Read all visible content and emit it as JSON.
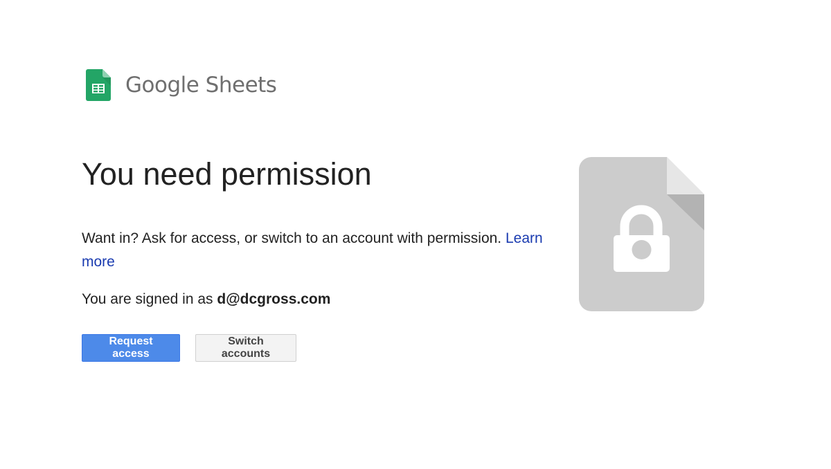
{
  "header": {
    "logo_icon": "google-sheets-icon",
    "product_name": "Google Sheets"
  },
  "main": {
    "title": "You need permission",
    "message_text": "Want in? Ask for access, or switch to an account with permission. ",
    "learn_more_label": "Learn more",
    "signed_in_prefix": "You are signed in as ",
    "signed_in_email": "d@dcgross.com"
  },
  "actions": {
    "request_access_label": "Request access",
    "switch_accounts_label": "Switch accounts"
  },
  "illustration": {
    "icon": "locked-file-icon"
  },
  "colors": {
    "primary_button": "#4d8ae9",
    "link": "#1a3bb0",
    "sheets_green": "#0f9d58",
    "illustration_gray": "#cccccc"
  }
}
